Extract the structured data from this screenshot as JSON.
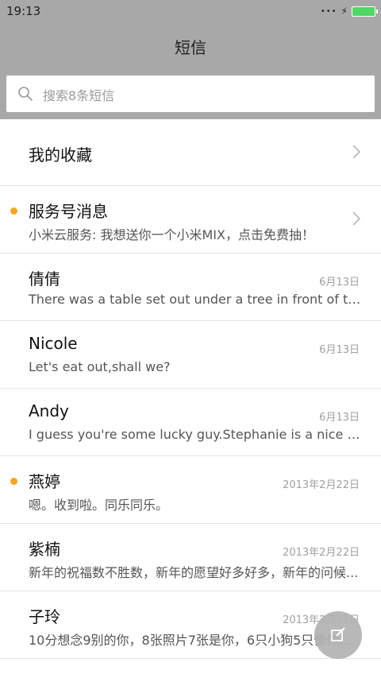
{
  "status_bar": {
    "time": "19:13",
    "signal_icon": "dots-icon",
    "charging_icon": "bolt-icon",
    "battery_color": "#4cd964"
  },
  "header": {
    "title": "短信",
    "background": "#a8a8a8"
  },
  "search": {
    "placeholder": "搜索8条短信"
  },
  "favorites": {
    "label": "我的收藏"
  },
  "conversations": [
    {
      "name": "服务号消息",
      "preview": "小米云服务: 我想送你一个小米MIX，点击免费抽！",
      "date": "",
      "unread": true,
      "chevron": true
    },
    {
      "name": "倩倩",
      "preview": "There was a table set out under a tree in front of the ho...",
      "date": "6月13日",
      "unread": false
    },
    {
      "name": "Nicole",
      "preview": "Let's eat out,shall we?",
      "date": "6月13日",
      "unread": false
    },
    {
      "name": "Andy",
      "preview": "I guess you're some lucky guy.Stephanie is a nice girl.",
      "date": "6月13日",
      "unread": false
    },
    {
      "name": "燕婷",
      "preview": "嗯。收到啦。同乐同乐。",
      "date": "2013年2月22日",
      "unread": true
    },
    {
      "name": "紫楠",
      "preview": "新年的祝福数不胜数，新年的愿望好多好多，新年的问候...",
      "date": "2013年2月22日",
      "unread": false
    },
    {
      "name": "子玲",
      "preview": "10分想念9别的你，8张照片7张是你，6只小狗5只像你...",
      "date": "2013年2月22日",
      "unread": false
    }
  ],
  "colors": {
    "unread_dot": "#f5a623",
    "accent_gray": "#b3b3b3"
  },
  "fab": {
    "icon": "compose-icon"
  }
}
